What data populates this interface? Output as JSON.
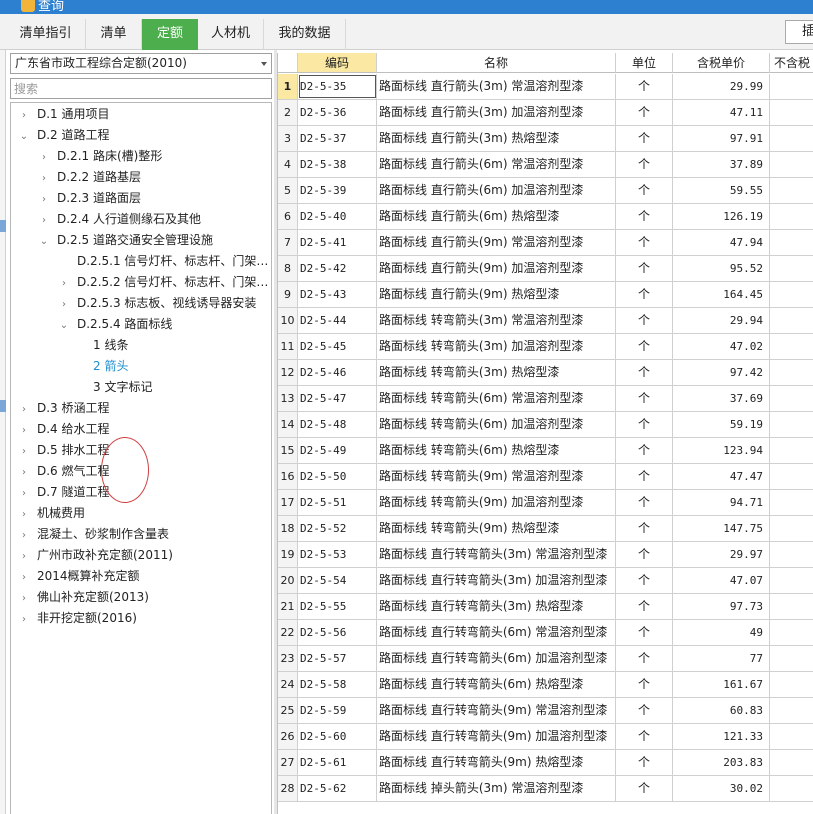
{
  "window": {
    "title": "查询"
  },
  "tabs": [
    {
      "label": "清单指引",
      "active": false
    },
    {
      "label": "清单",
      "active": false
    },
    {
      "label": "定额",
      "active": true
    },
    {
      "label": "人材机",
      "active": false
    },
    {
      "label": "我的数据",
      "active": false
    }
  ],
  "right_button_label": "插",
  "db_select": {
    "value": "广东省市政工程综合定额(2010)"
  },
  "search": {
    "placeholder": "搜索"
  },
  "tree": [
    {
      "label": "D.1 通用项目",
      "level": 0,
      "state": "collapsed"
    },
    {
      "label": "D.2 道路工程",
      "level": 0,
      "state": "expanded"
    },
    {
      "label": "D.2.1 路床(槽)整形",
      "level": 1,
      "state": "collapsed"
    },
    {
      "label": "D.2.2 道路基层",
      "level": 1,
      "state": "collapsed"
    },
    {
      "label": "D.2.3 道路面层",
      "level": 1,
      "state": "collapsed"
    },
    {
      "label": "D.2.4 人行道侧缘石及其他",
      "level": 1,
      "state": "collapsed"
    },
    {
      "label": "D.2.5 道路交通安全管理设施",
      "level": 1,
      "state": "expanded"
    },
    {
      "label": "D.2.5.1 信号灯杆、标志杆、门架…",
      "level": 2,
      "state": "none"
    },
    {
      "label": "D.2.5.2 信号灯杆、标志杆、门架…",
      "level": 2,
      "state": "collapsed"
    },
    {
      "label": "D.2.5.3 标志板、视线诱导器安装",
      "level": 2,
      "state": "collapsed"
    },
    {
      "label": "D.2.5.4 路面标线",
      "level": 2,
      "state": "expanded"
    },
    {
      "label": "1 线条",
      "level": 3,
      "state": "leaf"
    },
    {
      "label": "2 箭头",
      "level": 3,
      "state": "leaf",
      "selected": true
    },
    {
      "label": "3 文字标记",
      "level": 3,
      "state": "leaf"
    },
    {
      "label": "D.3 桥涵工程",
      "level": 0,
      "state": "collapsed"
    },
    {
      "label": "D.4 给水工程",
      "level": 0,
      "state": "collapsed"
    },
    {
      "label": "D.5 排水工程",
      "level": 0,
      "state": "collapsed"
    },
    {
      "label": "D.6 燃气工程",
      "level": 0,
      "state": "collapsed"
    },
    {
      "label": "D.7 隧道工程",
      "level": 0,
      "state": "collapsed"
    },
    {
      "label": "机械费用",
      "level": 0,
      "state": "collapsed"
    },
    {
      "label": "混凝土、砂浆制作含量表",
      "level": 0,
      "state": "collapsed"
    },
    {
      "label": "广州市政补充定额(2011)",
      "level": 0,
      "state": "collapsed"
    },
    {
      "label": "2014概算补充定额",
      "level": 0,
      "state": "collapsed"
    },
    {
      "label": "佛山补充定额(2013)",
      "level": 0,
      "state": "collapsed"
    },
    {
      "label": "非开挖定额(2016)",
      "level": 0,
      "state": "collapsed"
    }
  ],
  "table": {
    "columns": [
      "编码",
      "名称",
      "单位",
      "含税单价",
      "不含税"
    ],
    "rows": [
      {
        "idx": "1",
        "code": "D2-5-35",
        "name": "路面标线 直行箭头(3m) 常温溶剂型漆",
        "unit": "个",
        "price": "29.99"
      },
      {
        "idx": "2",
        "code": "D2-5-36",
        "name": "路面标线 直行箭头(3m) 加温溶剂型漆",
        "unit": "个",
        "price": "47.11"
      },
      {
        "idx": "3",
        "code": "D2-5-37",
        "name": "路面标线 直行箭头(3m) 热熔型漆",
        "unit": "个",
        "price": "97.91"
      },
      {
        "idx": "4",
        "code": "D2-5-38",
        "name": "路面标线 直行箭头(6m) 常温溶剂型漆",
        "unit": "个",
        "price": "37.89"
      },
      {
        "idx": "5",
        "code": "D2-5-39",
        "name": "路面标线 直行箭头(6m) 加温溶剂型漆",
        "unit": "个",
        "price": "59.55"
      },
      {
        "idx": "6",
        "code": "D2-5-40",
        "name": "路面标线 直行箭头(6m) 热熔型漆",
        "unit": "个",
        "price": "126.19"
      },
      {
        "idx": "7",
        "code": "D2-5-41",
        "name": "路面标线 直行箭头(9m) 常温溶剂型漆",
        "unit": "个",
        "price": "47.94"
      },
      {
        "idx": "8",
        "code": "D2-5-42",
        "name": "路面标线 直行箭头(9m) 加温溶剂型漆",
        "unit": "个",
        "price": "95.52"
      },
      {
        "idx": "9",
        "code": "D2-5-43",
        "name": "路面标线 直行箭头(9m) 热熔型漆",
        "unit": "个",
        "price": "164.45"
      },
      {
        "idx": "10",
        "code": "D2-5-44",
        "name": "路面标线 转弯箭头(3m) 常温溶剂型漆",
        "unit": "个",
        "price": "29.94"
      },
      {
        "idx": "11",
        "code": "D2-5-45",
        "name": "路面标线 转弯箭头(3m) 加温溶剂型漆",
        "unit": "个",
        "price": "47.02"
      },
      {
        "idx": "12",
        "code": "D2-5-46",
        "name": "路面标线 转弯箭头(3m) 热熔型漆",
        "unit": "个",
        "price": "97.42"
      },
      {
        "idx": "13",
        "code": "D2-5-47",
        "name": "路面标线 转弯箭头(6m) 常温溶剂型漆",
        "unit": "个",
        "price": "37.69"
      },
      {
        "idx": "14",
        "code": "D2-5-48",
        "name": "路面标线 转弯箭头(6m) 加温溶剂型漆",
        "unit": "个",
        "price": "59.19"
      },
      {
        "idx": "15",
        "code": "D2-5-49",
        "name": "路面标线 转弯箭头(6m) 热熔型漆",
        "unit": "个",
        "price": "123.94"
      },
      {
        "idx": "16",
        "code": "D2-5-50",
        "name": "路面标线 转弯箭头(9m) 常温溶剂型漆",
        "unit": "个",
        "price": "47.47"
      },
      {
        "idx": "17",
        "code": "D2-5-51",
        "name": "路面标线 转弯箭头(9m) 加温溶剂型漆",
        "unit": "个",
        "price": "94.71"
      },
      {
        "idx": "18",
        "code": "D2-5-52",
        "name": "路面标线 转弯箭头(9m) 热熔型漆",
        "unit": "个",
        "price": "147.75"
      },
      {
        "idx": "19",
        "code": "D2-5-53",
        "name": "路面标线 直行转弯箭头(3m) 常温溶剂型漆",
        "unit": "个",
        "price": "29.97"
      },
      {
        "idx": "20",
        "code": "D2-5-54",
        "name": "路面标线 直行转弯箭头(3m) 加温溶剂型漆",
        "unit": "个",
        "price": "47.07"
      },
      {
        "idx": "21",
        "code": "D2-5-55",
        "name": "路面标线 直行转弯箭头(3m) 热熔型漆",
        "unit": "个",
        "price": "97.73"
      },
      {
        "idx": "22",
        "code": "D2-5-56",
        "name": "路面标线 直行转弯箭头(6m) 常温溶剂型漆",
        "unit": "个",
        "price": "49"
      },
      {
        "idx": "23",
        "code": "D2-5-57",
        "name": "路面标线 直行转弯箭头(6m) 加温溶剂型漆",
        "unit": "个",
        "price": "77"
      },
      {
        "idx": "24",
        "code": "D2-5-58",
        "name": "路面标线 直行转弯箭头(6m) 热熔型漆",
        "unit": "个",
        "price": "161.67"
      },
      {
        "idx": "25",
        "code": "D2-5-59",
        "name": "路面标线 直行转弯箭头(9m) 常温溶剂型漆",
        "unit": "个",
        "price": "60.83"
      },
      {
        "idx": "26",
        "code": "D2-5-60",
        "name": "路面标线 直行转弯箭头(9m) 加温溶剂型漆",
        "unit": "个",
        "price": "121.33"
      },
      {
        "idx": "27",
        "code": "D2-5-61",
        "name": "路面标线 直行转弯箭头(9m) 热熔型漆",
        "unit": "个",
        "price": "203.83"
      },
      {
        "idx": "28",
        "code": "D2-5-62",
        "name": "路面标线 掉头箭头(3m) 常温溶剂型漆",
        "unit": "个",
        "price": "30.02"
      }
    ]
  }
}
